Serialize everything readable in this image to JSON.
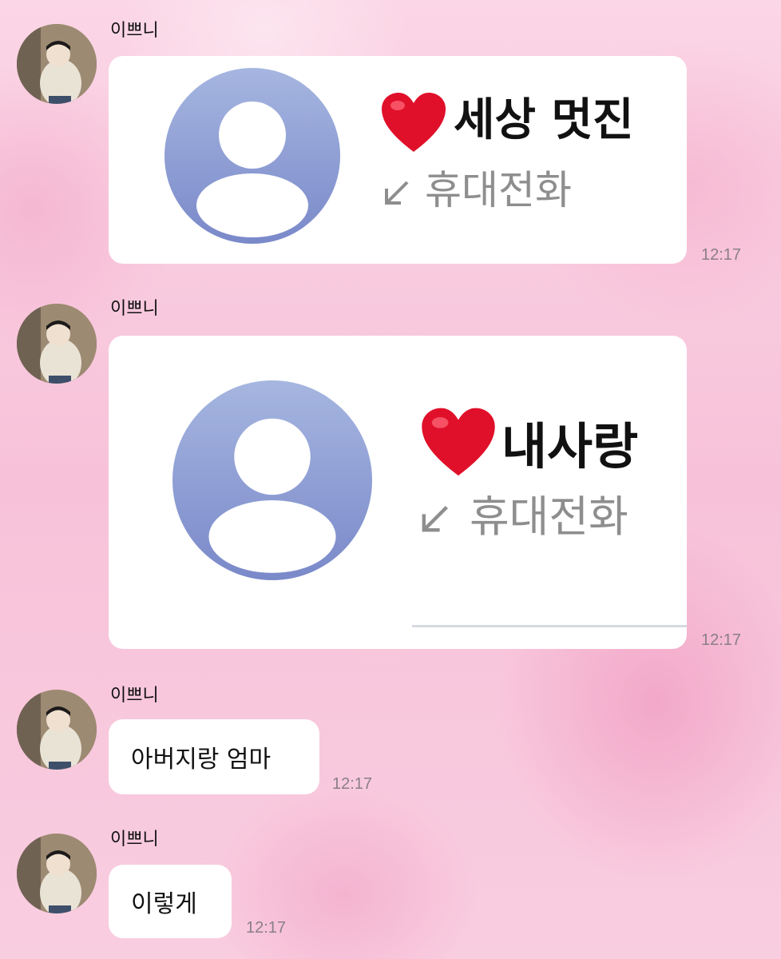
{
  "messages": [
    {
      "sender": "이쁘니",
      "type": "contact",
      "contact_name": "세상 멋진",
      "contact_label": "휴대전화",
      "time": "12:17"
    },
    {
      "sender": "이쁘니",
      "type": "contact",
      "contact_name": "내사랑",
      "contact_label": "휴대전화",
      "time": "12:17"
    },
    {
      "sender": "이쁘니",
      "type": "text",
      "text": "아버지랑 엄마",
      "time": "12:17"
    },
    {
      "sender": "이쁘니",
      "type": "text",
      "text": "이렇게",
      "time": "12:17"
    }
  ],
  "colors": {
    "background": "#f8c9dd",
    "bubble": "#ffffff",
    "person_icon_top": "#a4b3de",
    "person_icon_bottom": "#7c8ccb",
    "heart": "#e0102a"
  },
  "icons": {
    "avatar": "profile-photo",
    "contact": "person-icon",
    "heart": "heart-icon",
    "arrow": "incoming-call-arrow-icon"
  }
}
